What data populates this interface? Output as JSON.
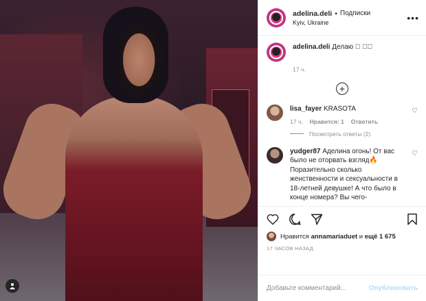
{
  "header": {
    "username": "adelina.deli",
    "dot": "•",
    "follow_label": "Подписки",
    "location": "Kyiv, Ukraine",
    "more_icon": "more-horizontal-icon"
  },
  "caption": {
    "username": "adelina.deli",
    "text": "Делаю ⃝ ⃝⃝",
    "time": "17 ч."
  },
  "load_more_icon": "plus-circle-icon",
  "comments": [
    {
      "username": "lisa_fayer",
      "text": "KRASOTA",
      "time": "17 ч.",
      "likes": "Нравится: 1",
      "reply": "Ответить",
      "view_replies": "Посмотреть ответы (2)"
    },
    {
      "username": "yudger87",
      "text": "Аделина огонь! От вас было не оторвать взгляд🔥 Поразительно сколько женственности и сексуальности в 18-летней девушке! А что было в конце номера? Вы чего-"
    }
  ],
  "liked_by": {
    "prefix": "Нравится",
    "user": "annamariaduet",
    "and": "и",
    "others": "ещё 1 675"
  },
  "posted_ago": "17 ЧАСОВ НАЗАД",
  "add_comment": {
    "placeholder": "Добавьте комментарий...",
    "publish_label": "Опубликовать"
  },
  "colors": {
    "text": "#262626",
    "secondary": "#8e8e8e",
    "publish_disabled": "#b2dffc",
    "border": "#efefef"
  }
}
